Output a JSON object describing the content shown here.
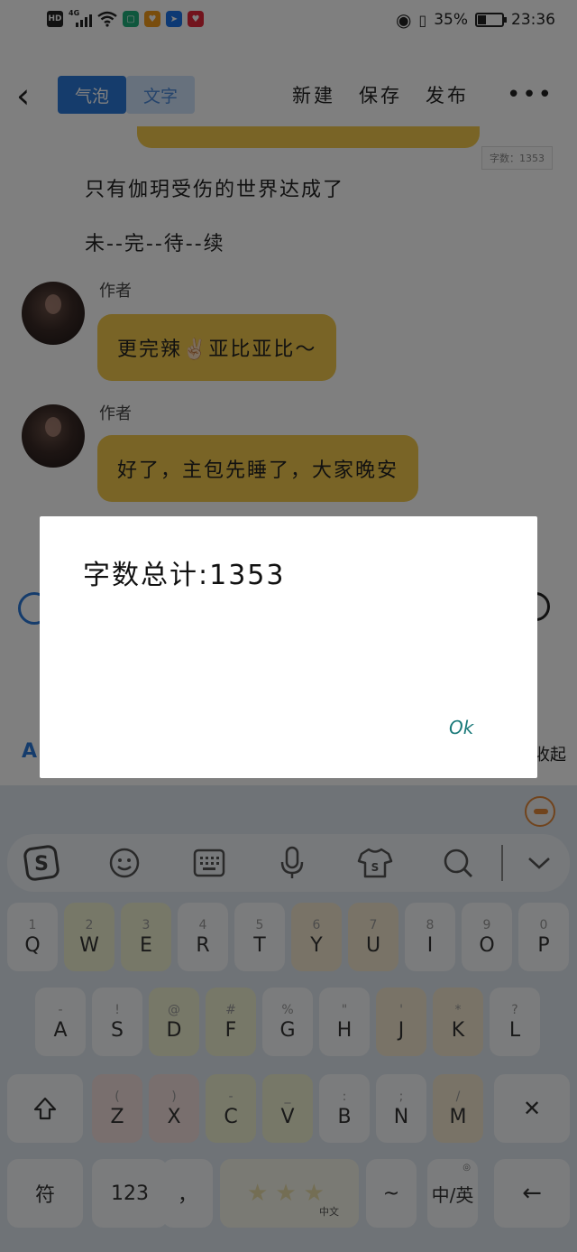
{
  "status_bar": {
    "hd": "HD",
    "network": "4G",
    "battery_pct": "35%",
    "battery_level": 0.35,
    "time": "23:36"
  },
  "header": {
    "back_icon": "chevron-left-icon",
    "tabs": [
      {
        "label": "气泡",
        "active": true
      },
      {
        "label": "文字",
        "active": false
      }
    ],
    "actions": [
      "新建",
      "保存",
      "发布"
    ],
    "more_icon": "more-horizontal-icon"
  },
  "editor": {
    "word_count_badge": "字数：1353",
    "lines": [
      "只有伽玥受伤的世界达成了",
      "未--完--待--续"
    ],
    "messages": [
      {
        "author": "作者",
        "text": "更完辣✌🏻亚比亚比～"
      },
      {
        "author": "作者",
        "text": "好了，主包先睡了，大家晚安"
      }
    ],
    "underlay_font_icon": "A",
    "underlay_collapse": "收起"
  },
  "dialog": {
    "message": "字数总计:1353",
    "ok": "Ok"
  },
  "keyboard": {
    "toolbar_icons": [
      "sogou-logo-icon",
      "emoji-icon",
      "keyboard-icon",
      "microphone-icon",
      "skin-shirt-icon",
      "search-icon",
      "chevron-down-icon"
    ],
    "rows": [
      [
        {
          "k": "Q",
          "h": "1"
        },
        {
          "k": "W",
          "h": "2"
        },
        {
          "k": "E",
          "h": "3"
        },
        {
          "k": "R",
          "h": "4"
        },
        {
          "k": "T",
          "h": "5"
        },
        {
          "k": "Y",
          "h": "6"
        },
        {
          "k": "U",
          "h": "7"
        },
        {
          "k": "I",
          "h": "8"
        },
        {
          "k": "O",
          "h": "9"
        },
        {
          "k": "P",
          "h": "0"
        }
      ],
      [
        {
          "k": "A",
          "h": "-"
        },
        {
          "k": "S",
          "h": "!"
        },
        {
          "k": "D",
          "h": "@"
        },
        {
          "k": "F",
          "h": "#"
        },
        {
          "k": "G",
          "h": "%"
        },
        {
          "k": "H",
          "h": "\""
        },
        {
          "k": "J",
          "h": "'"
        },
        {
          "k": "K",
          "h": "*"
        },
        {
          "k": "L",
          "h": "?"
        }
      ],
      [
        {
          "k": "Z",
          "h": "("
        },
        {
          "k": "X",
          "h": ")"
        },
        {
          "k": "C",
          "h": "-"
        },
        {
          "k": "V",
          "h": "_"
        },
        {
          "k": "B",
          "h": ":"
        },
        {
          "k": "N",
          "h": ";"
        },
        {
          "k": "M",
          "h": "/"
        }
      ]
    ],
    "shift_icon": "shift-up-icon",
    "delete_key": "✕",
    "bottom": {
      "symbols": "符",
      "numbers": "123",
      "comma": "，",
      "space_lang": "中文",
      "tilde": "~",
      "lang_switch": "中/英",
      "enter": "←"
    }
  }
}
